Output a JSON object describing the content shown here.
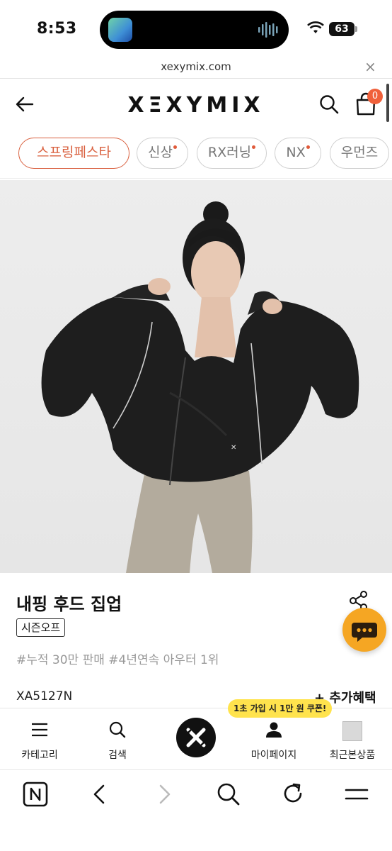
{
  "status_bar": {
    "time": "8:53",
    "battery": "63"
  },
  "browser": {
    "url": "xexymix.com",
    "close": "×"
  },
  "header": {
    "logo": "XΞXYMIX",
    "cart_count": "0"
  },
  "chips": [
    {
      "label": "스프링페스타",
      "dot": false,
      "active": true
    },
    {
      "label": "신상",
      "dot": true,
      "active": false
    },
    {
      "label": "RX러닝",
      "dot": true,
      "active": false
    },
    {
      "label": "NX",
      "dot": true,
      "active": false
    },
    {
      "label": "우먼즈",
      "dot": false,
      "active": false
    }
  ],
  "product": {
    "name": "내핑 후드 집업",
    "tag": "시즌오프",
    "hashtags": "#누적 30만 판매 #4년연속 아우터 1위",
    "code": "XA5127N",
    "benefit": "+ 추가혜택"
  },
  "bottom_nav": {
    "coupon": "1초 가입 시 1만 원 쿠폰!",
    "items": [
      "카테고리",
      "검색",
      "마이페이지",
      "최근본상품"
    ]
  },
  "colors": {
    "accent": "#d9603f",
    "badge": "#f0603a",
    "chat": "#f5a623",
    "coupon": "#ffe34d"
  }
}
